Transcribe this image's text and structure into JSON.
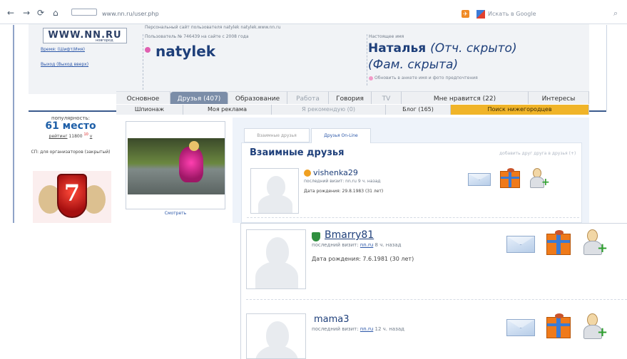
{
  "browser": {
    "url": "www.nn.ru/user.php",
    "search_placeholder": "Искать в Google",
    "nav": {
      "back": "←",
      "forward": "→",
      "reload": "⟳",
      "home": "⌂"
    }
  },
  "header": {
    "logo": "WWW.NN.RU",
    "logo_sub": "новгород",
    "visit_links": "Время: (Шифт/Имя)",
    "logout": "Выход (Выход вверх)",
    "site_owner_label": "Персональный сайт пользователя natylek natylek.www.nn.ru",
    "user_num_label": "Пользователь № 746439 на сайте с 2008 года",
    "nickname": "natylek",
    "realname_label": "Настоящее имя",
    "realname_first": "Наталья",
    "realname_patronymic": "(Отч. скрыто)",
    "realname_surname": "(Фам. скрыта)",
    "profile_note": "Обновить в анкете имя и фото предпочтения"
  },
  "tabs_primary": [
    {
      "label": "Основное"
    },
    {
      "label": "Друзья (407)"
    },
    {
      "label": "Образование"
    },
    {
      "label": "Работа"
    },
    {
      "label": "Говория"
    },
    {
      "label": "TV"
    },
    {
      "label": "Мне нравится (22)"
    },
    {
      "label": "Интересы"
    }
  ],
  "tabs_secondary": [
    {
      "label": "Шпионаж"
    },
    {
      "label": "Моя реклама"
    },
    {
      "label": "Я рекомендую (0)"
    },
    {
      "label": "Блог (165)"
    },
    {
      "label": "Поиск нижегородцев"
    }
  ],
  "sidebar": {
    "popularity_label": "популярность:",
    "rank": "61 место",
    "rating_prefix": "рейтинг",
    "rating_value": "11800",
    "rating_delta": "10",
    "rating_suffix": "v",
    "sp_label": "СП: для организаторов (закрытый)",
    "badge_number": "7"
  },
  "photo": {
    "caption": "Смотреть"
  },
  "friends": {
    "tab_mutual": "Взаимные друзья",
    "tab_online": "Друзья On-Line",
    "title": "Взаимные друзья",
    "add_link": "добавить друг друга в друзья (+)",
    "first": {
      "name": "vishenka29",
      "last_visit": "последний визит: nn.ru 9 ч. назад",
      "birthday": "Дата рождения: 29.8.1983 (31 лет)"
    },
    "zoom": [
      {
        "name": "Bmarry81",
        "last_visit_prefix": "последний визит:",
        "site": "nn.ru",
        "last_visit_suffix": "8 ч. назад",
        "birthday": "Дата рождения: 7.6.1981 (30 лет)"
      },
      {
        "name": "mama3",
        "last_visit_prefix": "последний визит:",
        "site": "nn.ru",
        "last_visit_suffix": "12 ч. назад",
        "birthday": ""
      }
    ]
  }
}
